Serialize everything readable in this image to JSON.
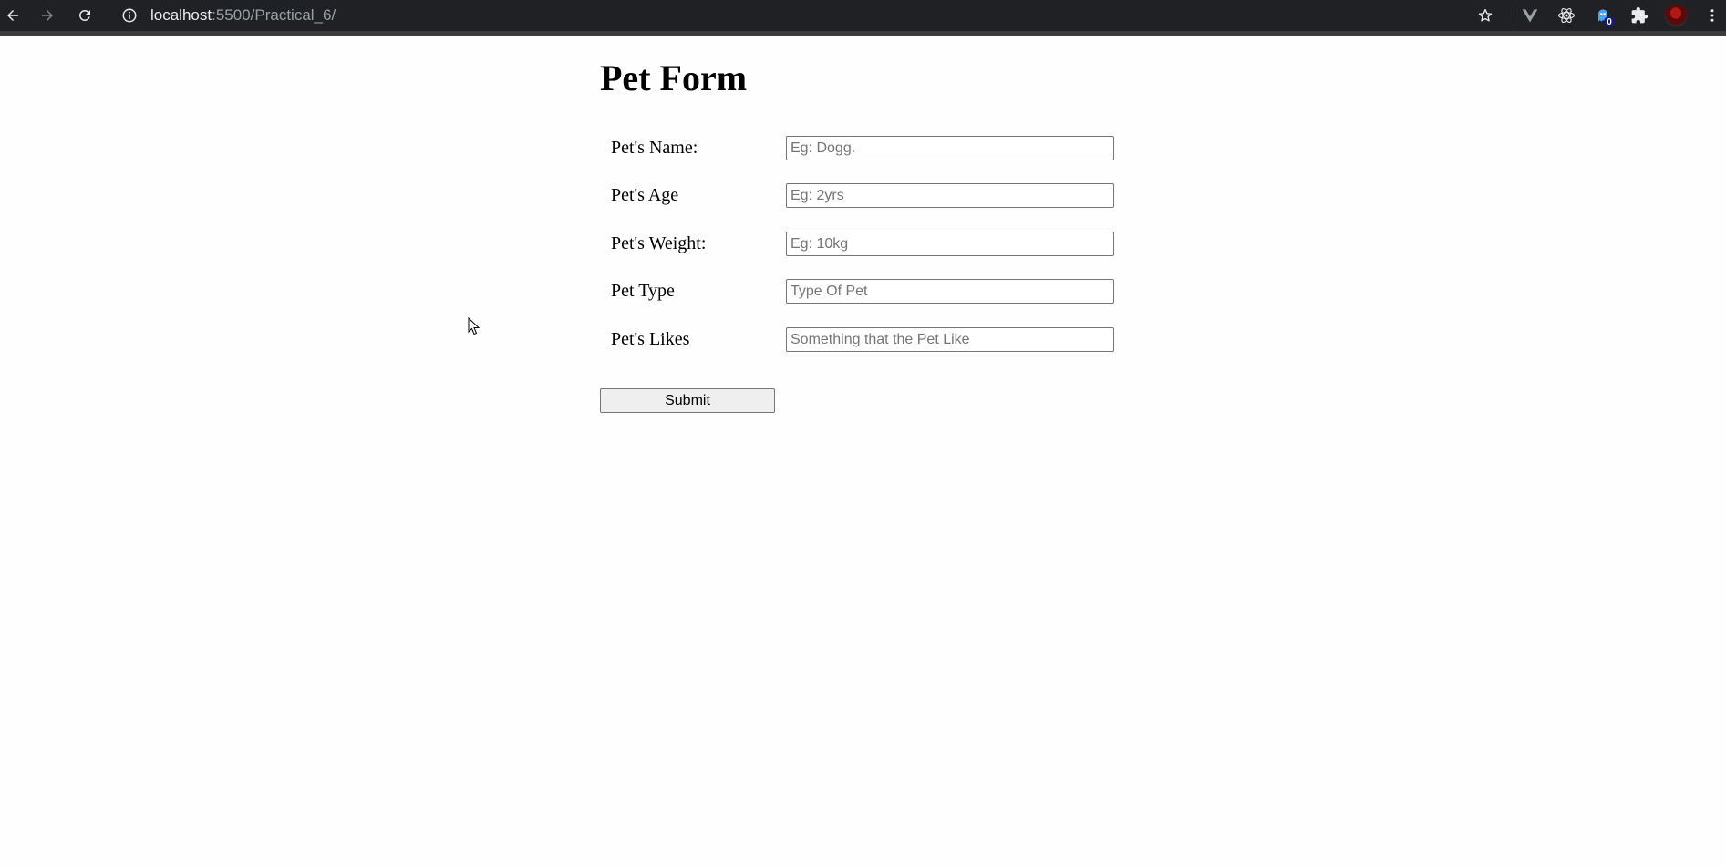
{
  "browser": {
    "url_host": "localhost",
    "url_rest": ":5500/Practical_6/",
    "extension_badge": "0",
    "icons": [
      "back-icon",
      "forward-icon",
      "reload-icon",
      "info-icon",
      "star-icon",
      "vue-devtools-icon",
      "react-devtools-icon",
      "ghost-extension-icon",
      "puzzle-icon",
      "avatar",
      "more-icon"
    ]
  },
  "page": {
    "title": "Pet Form",
    "fields": [
      {
        "label": "Pet's Name:",
        "placeholder": "Eg: Dogg.",
        "value": ""
      },
      {
        "label": "Pet's Age",
        "placeholder": "Eg: 2yrs",
        "value": ""
      },
      {
        "label": "Pet's Weight:",
        "placeholder": "Eg: 10kg",
        "value": ""
      },
      {
        "label": "Pet Type",
        "placeholder": "Type Of Pet",
        "value": ""
      },
      {
        "label": "Pet's Likes",
        "placeholder": "Something that the Pet Like",
        "value": ""
      }
    ],
    "submit_label": "Submit"
  },
  "colors": {
    "chrome_bg": "#202124",
    "page_bg": "#fefefe",
    "vue_green": "#42b883",
    "react_cyan": "#61dafb"
  }
}
